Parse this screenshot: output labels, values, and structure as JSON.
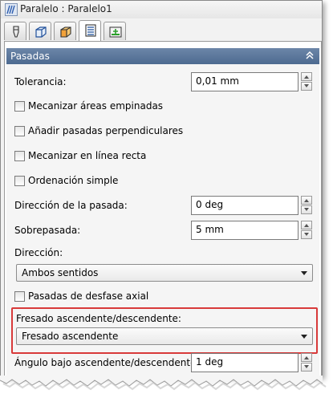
{
  "window": {
    "title": "Paralelo : Paralelo1"
  },
  "tabs": [
    {
      "icon": "tool-icon"
    },
    {
      "icon": "stock-box-icon"
    },
    {
      "icon": "limits-box-icon"
    },
    {
      "icon": "passes-list-icon"
    },
    {
      "icon": "linking-icon"
    }
  ],
  "section": {
    "title": "Pasadas",
    "colors": {
      "header_start": "#6c86a8",
      "header_end": "#4d6a90"
    }
  },
  "fields": {
    "tolerancia": {
      "label": "Tolerancia:",
      "value": "0,01 mm"
    },
    "mecanizar_empinadas": {
      "label": "Mecanizar áreas empinadas",
      "checked": false
    },
    "pasadas_perpendiculares": {
      "label": "Añadir pasadas perpendiculares",
      "checked": false
    },
    "linea_recta": {
      "label": "Mecanizar en línea recta",
      "checked": false
    },
    "ordenacion_simple": {
      "label": "Ordenación simple",
      "checked": false
    },
    "direccion_pasada": {
      "label": "Dirección de la pasada:",
      "value": "0 deg"
    },
    "sobrepasada": {
      "label": "Sobrepasada:",
      "value": "5 mm"
    },
    "direccion": {
      "label": "Dirección:",
      "selected": "Ambos sentidos"
    },
    "desfase_axial": {
      "label": "Pasadas de desfase axial",
      "checked": false
    },
    "fresado": {
      "label": "Fresado ascendente/descendente:",
      "selected": "Fresado ascendente"
    },
    "angulo_bajo": {
      "label": "Ángulo bajo ascendente/descendente:",
      "value": "1 deg"
    }
  },
  "highlight_color": "#d83a3a"
}
